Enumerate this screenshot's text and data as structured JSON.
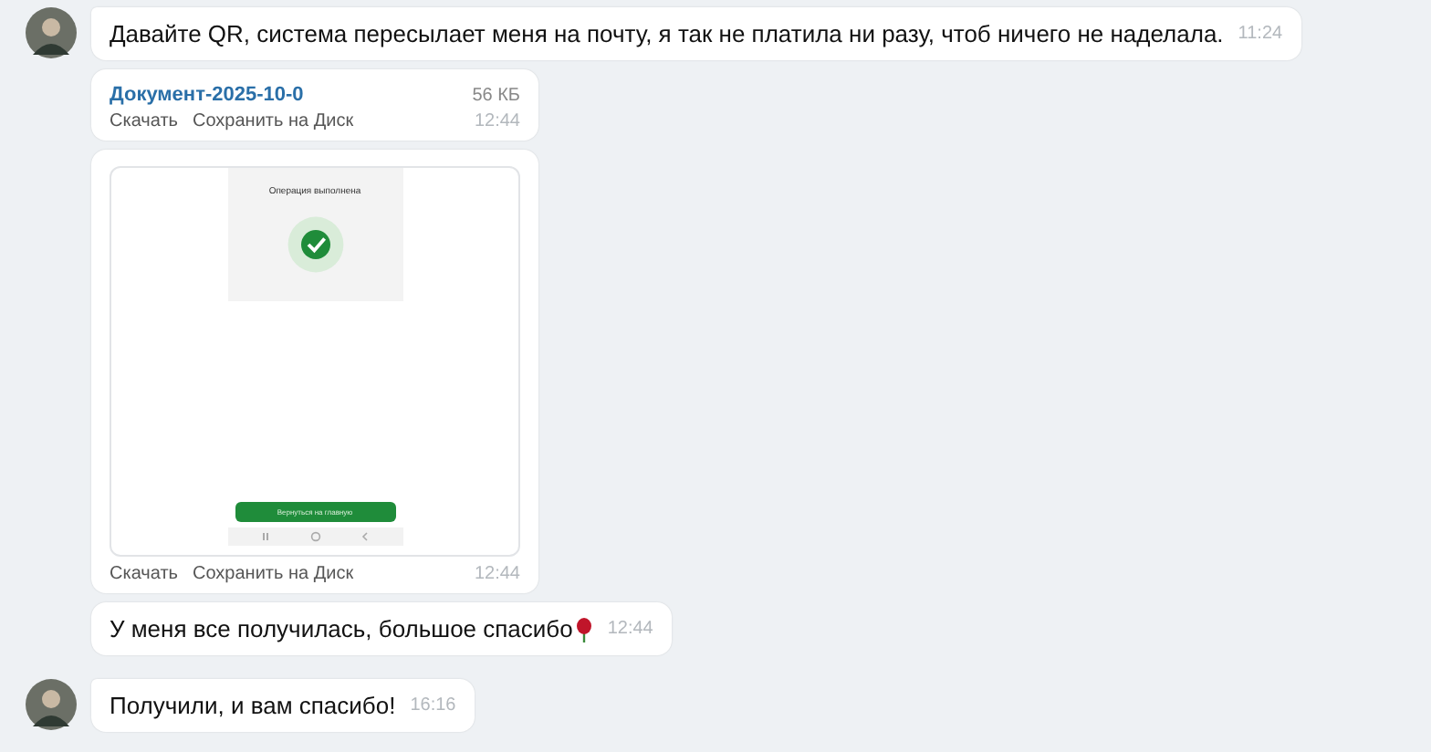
{
  "messages": [
    {
      "kind": "text",
      "avatar": true,
      "text": "Давайте QR, система пересылает меня на почту, я так не платила ни разу, чтоб ничего не наделала.",
      "time": "11:24",
      "emoji": false
    },
    {
      "kind": "file",
      "avatar": false,
      "file_name": "Документ-2025-10-0",
      "size": "56 КБ",
      "actions": [
        "Скачать",
        "Сохранить на Диск"
      ],
      "time": "12:44"
    },
    {
      "kind": "image",
      "avatar": false,
      "screen_title": "Операция выполнена",
      "screen_button": "Вернуться на главную",
      "actions": [
        "Скачать",
        "Сохранить на Диск"
      ],
      "time": "12:44"
    },
    {
      "kind": "text",
      "avatar": false,
      "text": "У меня все получилась, большое спасибо",
      "time": "12:44",
      "emoji": true
    },
    {
      "kind": "text",
      "avatar": true,
      "text": "Получили, и вам спасибо!",
      "time": "16:16",
      "emoji": false
    }
  ]
}
